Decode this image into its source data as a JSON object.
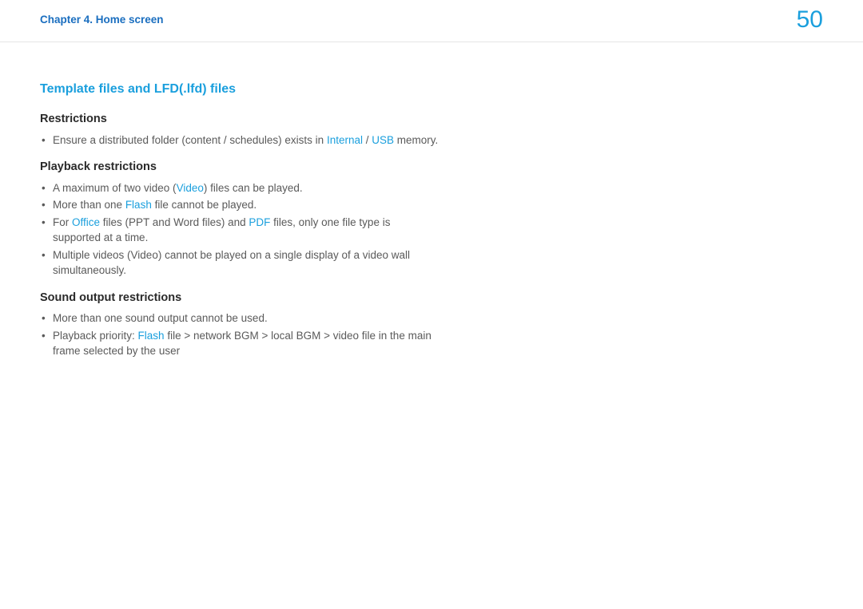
{
  "header": {
    "breadcrumb": "Chapter 4. Home screen",
    "page_number": "50"
  },
  "section": {
    "title": "Template files and LFD(.lfd) files",
    "restrictions": {
      "heading": "Restrictions",
      "items": [
        {
          "pre": "Ensure a distributed folder (content / schedules) exists in ",
          "hl1": "Internal",
          "mid": " / ",
          "hl2": "USB",
          "post": " memory."
        }
      ]
    },
    "playback": {
      "heading": "Playback restrictions",
      "items": [
        {
          "pre": "A maximum of two video (",
          "hl1": "Video",
          "post": ") files can be played."
        },
        {
          "pre": "More than one ",
          "hl1": "Flash",
          "post": " file cannot be played."
        },
        {
          "pre": "For ",
          "hl1": "Office",
          "mid": " files (PPT and Word files) and ",
          "hl2": "PDF",
          "post": " files, only one file type is supported at a time."
        },
        {
          "pre": "Multiple videos (Video) cannot be played on a single display of a video wall simultaneously."
        }
      ]
    },
    "sound": {
      "heading": "Sound output restrictions",
      "items": [
        {
          "pre": "More than one sound output cannot be used."
        },
        {
          "pre": "Playback priority: ",
          "hl1": "Flash",
          "post": " file > network BGM > local BGM > video file in the main frame selected by the user"
        }
      ]
    }
  }
}
